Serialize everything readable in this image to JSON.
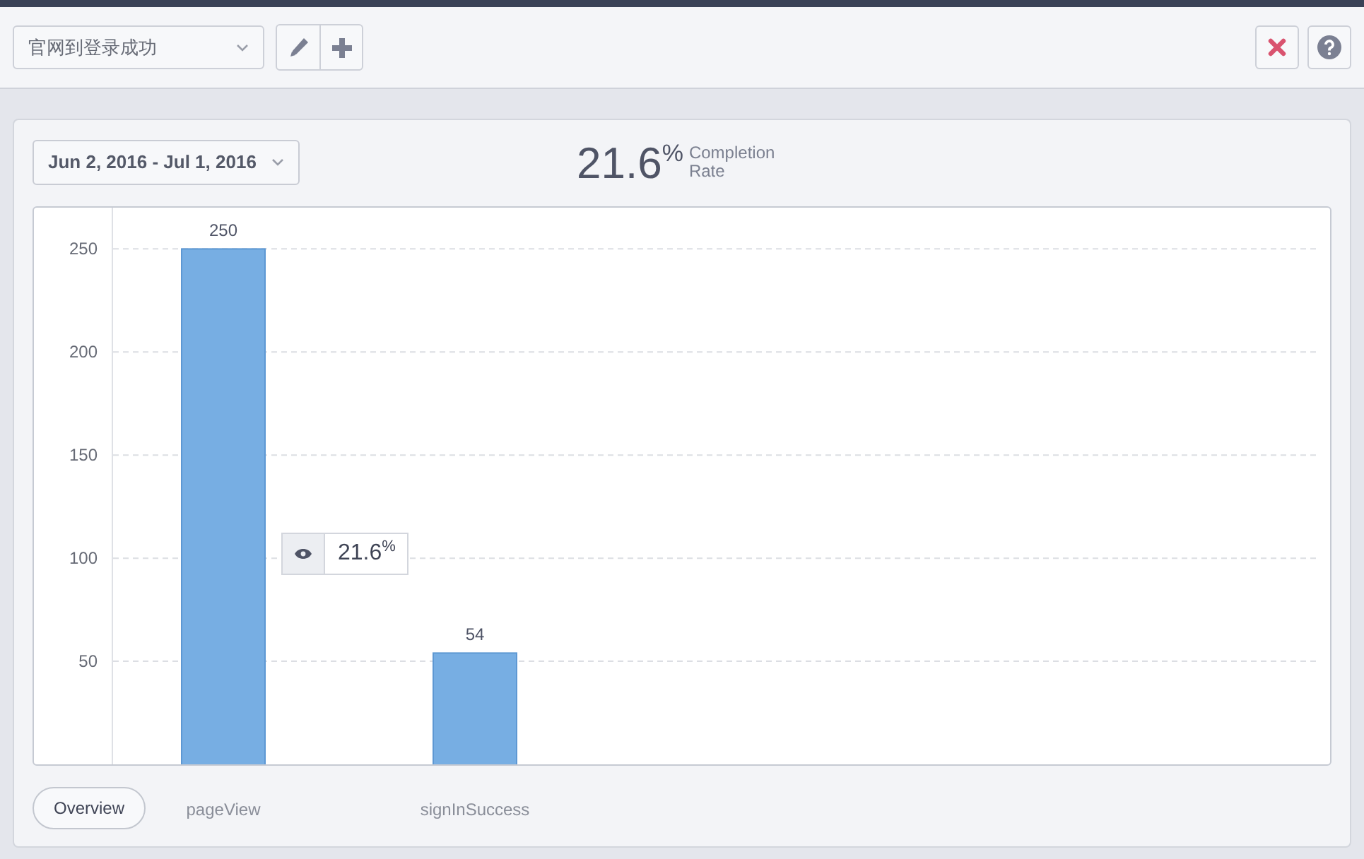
{
  "funnel_select": {
    "value": "官网到登录成功"
  },
  "toolbar_buttons": [
    {
      "kind": "edit"
    },
    {
      "kind": "add"
    }
  ],
  "right_buttons": [
    {
      "kind": "delete"
    },
    {
      "kind": "help"
    }
  ],
  "date_range": {
    "value": "Jun 2, 2016 - Jul 1, 2016"
  },
  "completion": {
    "value": "21.6$^{%}$",
    "label": "Completion Rate"
  },
  "chart_data": {
    "type": "bar",
    "categories": [
      "pageView",
      "signInSuccess"
    ],
    "series": [
      {
        "color": "#77aee3",
        "values": [
          250,
          54
        ]
      }
    ],
    "ylim": [
      0,
      270
    ],
    "yticks": [
      50,
      100,
      150,
      200,
      250
    ],
    "data_labels": true,
    "grid": true
  },
  "conversion_tooltip": {
    "value": "21.6$^{%}$"
  },
  "overview_button": {
    "label": "Overview",
    "selected": true
  }
}
